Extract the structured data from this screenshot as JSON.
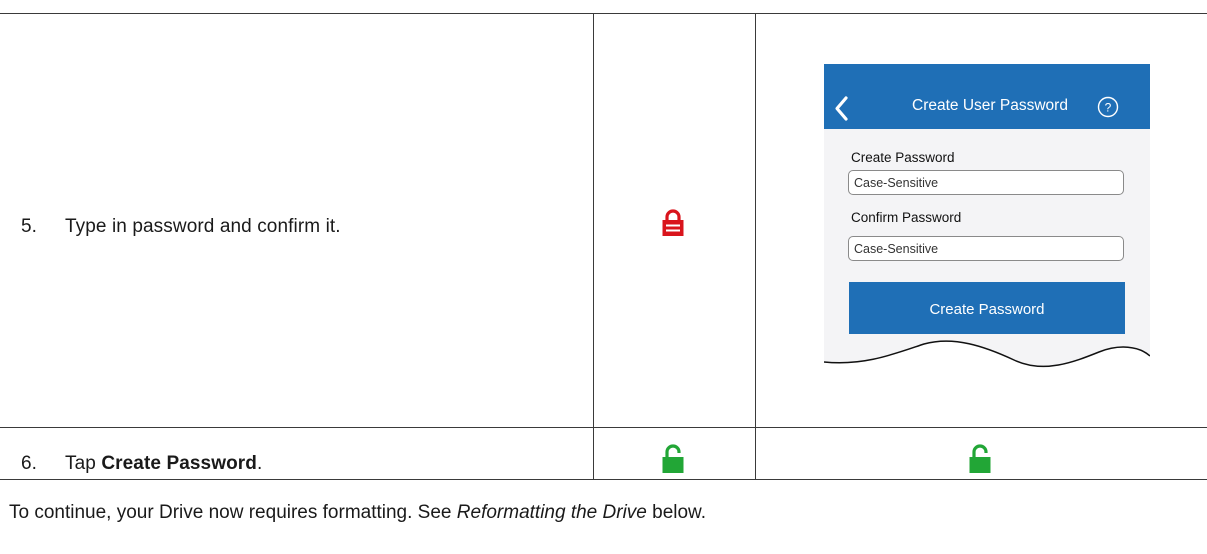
{
  "rows": [
    {
      "number": "5.",
      "text": "Type in password and confirm it.",
      "lock_icon": "locked-padlock-icon",
      "lock_color": "#d9141c"
    },
    {
      "number": "6.",
      "text_prefix": "Tap ",
      "text_bold": "Create Password",
      "text_suffix": ".",
      "lock_icon": "unlocked-padlock-icon",
      "lock_color": "#22a636",
      "screen_lock_icon": "unlocked-padlock-icon"
    }
  ],
  "phone": {
    "header_color": "#1f6fb6",
    "back_icon": "chevron-left-icon",
    "title": "Create User Password",
    "help_icon": "question-circle-icon",
    "create_label": "Create Password",
    "create_placeholder": "Case-Sensitive",
    "confirm_label": "Confirm Password",
    "confirm_placeholder": "Case-Sensitive",
    "button_label": "Create Password"
  },
  "footer": {
    "prefix": "To continue, your Drive now requires formatting. See ",
    "link_italic": "Reformatting the Drive",
    "suffix": " below."
  }
}
